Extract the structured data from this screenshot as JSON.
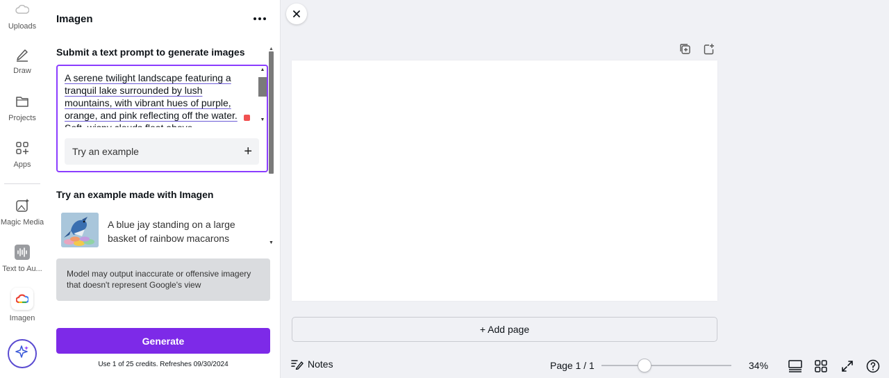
{
  "rail": {
    "items": [
      {
        "label": "Uploads",
        "icon": "cloud-upload-icon"
      },
      {
        "label": "Draw",
        "icon": "pen-icon"
      },
      {
        "label": "Projects",
        "icon": "folder-icon"
      },
      {
        "label": "Apps",
        "icon": "apps-grid-icon"
      },
      {
        "label": "Magic Media",
        "icon": "magic-media-icon"
      },
      {
        "label": "Text to Au...",
        "icon": "audio-wave-icon"
      },
      {
        "label": "Imagen",
        "icon": "google-cloud-icon"
      }
    ],
    "magic_button_icon": "sparkle-icon"
  },
  "panel": {
    "title": "Imagen",
    "prompt_heading": "Submit a text prompt to generate images",
    "prompt_text": "A serene twilight landscape featuring a tranquil lake surrounded by lush mountains, with vibrant hues of purple, orange, and pink reflecting off the water. Soft, wispy clouds float above",
    "try_example_label": "Try an example",
    "examples_heading": "Try an example made with Imagen",
    "example_caption": "A blue jay standing on a large basket of rainbow macarons",
    "disclaimer": "Model may output inaccurate or offensive imagery that doesn't represent Google's view",
    "generate_label": "Generate",
    "credits_text": "Use 1 of 25 credits. Refreshes 09/30/2024"
  },
  "canvas": {
    "add_page_label": "+ Add page"
  },
  "bottom_bar": {
    "notes_label": "Notes",
    "page_indicator": "Page 1 / 1",
    "zoom_label": "34%",
    "zoom_level": 0.34
  },
  "colors": {
    "accent": "#7d2ae8",
    "prompt_border": "#8b3dff"
  }
}
